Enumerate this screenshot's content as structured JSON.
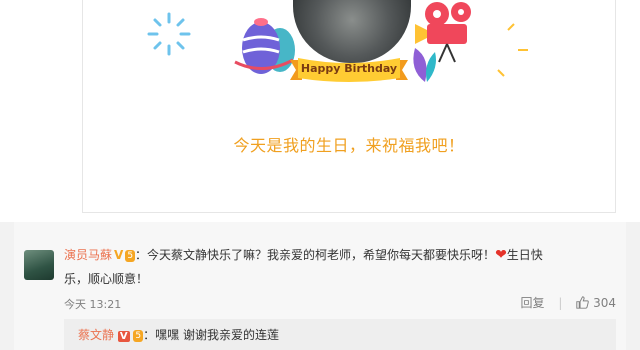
{
  "card": {
    "badge_text": "Happy Birthday",
    "greeting": "今天是我的生日，来祝福我吧！"
  },
  "comment": {
    "user": "演员马蘇",
    "verified": "V",
    "level": "5",
    "text_line1": "：今天蔡文静快乐了嘛？我亲爱的柯老师，希望你每天都要快乐呀！",
    "heart_icon": "heart",
    "text_line1_end": "生日快",
    "text_line2": "乐，顺心顺意！",
    "time": "今天 13:21",
    "reply_label": "回复",
    "like_count": "304"
  },
  "reply": {
    "user": "蔡文静",
    "verified": "V",
    "level": "5",
    "text": "：嘿嘿 谢谢我亲爱的连莲"
  },
  "colors": {
    "username": "#eb7350",
    "greeting": "#f0a020",
    "heart": "#e5332a",
    "verified": "#f5a623"
  }
}
